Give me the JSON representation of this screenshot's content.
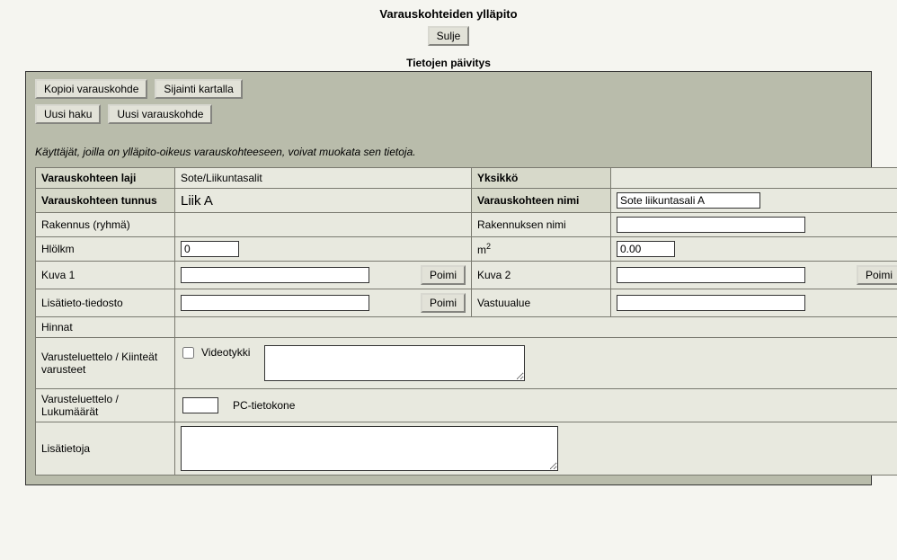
{
  "page": {
    "title": "Varauskohteiden ylläpito",
    "close": "Sulje",
    "section": "Tietojen päivitys"
  },
  "toolbar": {
    "copy": "Kopioi varauskohde",
    "map": "Sijainti kartalla",
    "newSearch": "Uusi haku",
    "newTarget": "Uusi varauskohde"
  },
  "help": "Käyttäjät, joilla on ylläpito-oikeus varauskohteeseen, voivat muokata sen tietoja.",
  "labels": {
    "type": "Varauskohteen laji",
    "unit": "Yksikkö",
    "id": "Varauskohteen tunnus",
    "name": "Varauskohteen nimi",
    "buildingGroup": "Rakennus (ryhmä)",
    "buildingName": "Rakennuksen nimi",
    "personCount": "Hlölkm",
    "m2_a": "m",
    "m2_b": "2",
    "image1": "Kuva 1",
    "image2": "Kuva 2",
    "pick": "Poimi",
    "infoFile": "Lisätieto-tiedosto",
    "responsibility": "Vastuualue",
    "prices": "Hinnat",
    "equipFixed": "Varusteluettelo / Kiinteät varusteet",
    "equipCount": "Varusteluettelo / Lukumäärät",
    "additional": "Lisätietoja",
    "videoProjector": "Videotykki",
    "pcComputer": "PC-tietokone"
  },
  "values": {
    "type": "Sote/Liikuntasalit",
    "unit": "",
    "id": "Liik A",
    "name": "Sote liikuntasali A",
    "buildingGroup": "",
    "buildingName": "",
    "personCount": "0",
    "m2": "0.00",
    "image1": "",
    "image2": "",
    "infoFile": "",
    "responsibility": "",
    "equipFixedText": "",
    "equipCountVal": "",
    "additional": ""
  }
}
